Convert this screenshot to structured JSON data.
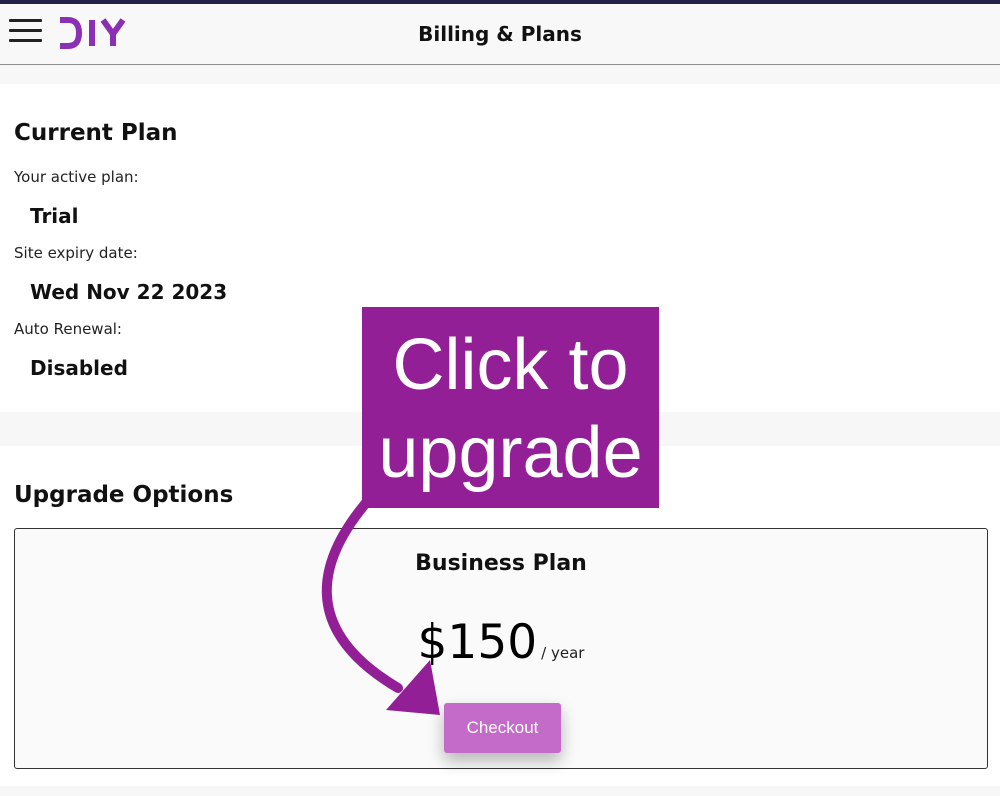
{
  "header": {
    "menu_icon": "hamburger-menu-icon",
    "logo_text": "DIY",
    "title": "Billing & Plans"
  },
  "current_plan": {
    "title": "Current Plan",
    "active_plan_label": "Your active plan:",
    "active_plan_value": "Trial",
    "expiry_label": "Site expiry date:",
    "expiry_value": "Wed Nov 22 2023",
    "auto_renewal_label": "Auto Renewal:",
    "auto_renewal_value": "Disabled"
  },
  "upgrade": {
    "title": "Upgrade Options",
    "plan_name": "Business Plan",
    "price": "$150",
    "period": "/ year",
    "checkout_label": "Checkout"
  },
  "annotation": {
    "line1": "Click to",
    "line2": "upgrade",
    "arrow_icon": "curved-arrow-icon"
  },
  "colors": {
    "brand_purple": "#931f97",
    "logo_purple": "#8b2fb5",
    "button": "#c46ac8",
    "topline": "#23214a"
  }
}
